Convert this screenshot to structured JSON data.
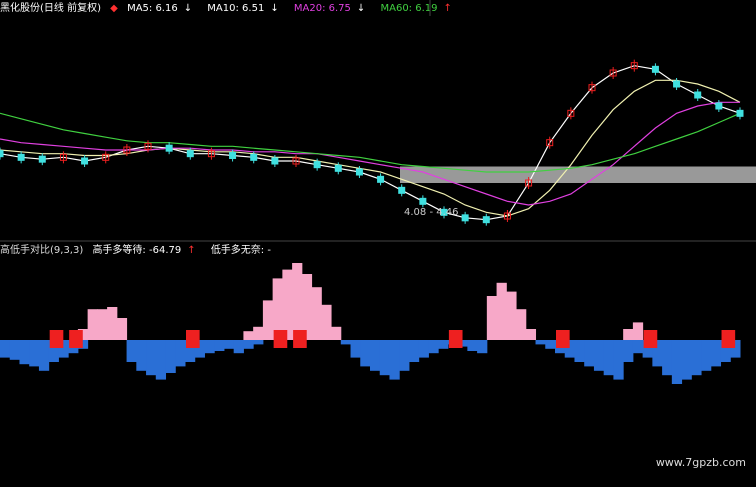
{
  "top_legend": {
    "stock": "黑化股份(日线 前复权)",
    "ma5": {
      "label": "MA5: 6.16",
      "arrow": "↓",
      "color": "#ffffff"
    },
    "ma10": {
      "label": "MA10: 6.51",
      "arrow": "↓",
      "color": "#ffffff"
    },
    "ma20": {
      "label": "MA20: 6.75",
      "arrow": "↓",
      "color": "#e040e0"
    },
    "ma60": {
      "label": "MA60: 6.19",
      "arrow": "↑",
      "color": "#40d040"
    }
  },
  "bottom_legend": {
    "indicator": "高低手对比(9,3,3)",
    "high": {
      "label": "高手多等待: -64.79",
      "arrow": "↑"
    },
    "low": {
      "label": "低手多无奈: -"
    }
  },
  "annotation": "4.08 - 4.46",
  "watermark": "www.7gpzb.com",
  "colors": {
    "pink": "#f7a8c8",
    "blue": "#2a6fd6",
    "red": "#ee2020",
    "cyan": "#40e0e0",
    "ma5": "#ffffff",
    "ma10": "#f0f0b0",
    "ma20": "#e040e0",
    "ma60": "#40d040",
    "zone": "#999999"
  },
  "chart_data": [
    {
      "type": "line",
      "title": "",
      "series": [
        {
          "name": "MA5",
          "values": [
            6.3,
            6.2,
            6.15,
            6.2,
            6.1,
            6.2,
            6.4,
            6.5,
            6.45,
            6.3,
            6.3,
            6.25,
            6.2,
            6.1,
            6.1,
            6.0,
            5.9,
            5.8,
            5.6,
            5.3,
            5.0,
            4.7,
            4.55,
            4.5,
            4.6,
            5.5,
            6.6,
            7.4,
            8.1,
            8.5,
            8.7,
            8.6,
            8.2,
            7.9,
            7.6,
            7.4
          ]
        },
        {
          "name": "MA10",
          "values": [
            6.4,
            6.35,
            6.3,
            6.3,
            6.25,
            6.25,
            6.3,
            6.4,
            6.45,
            6.4,
            6.35,
            6.35,
            6.3,
            6.2,
            6.2,
            6.1,
            6.0,
            5.9,
            5.8,
            5.6,
            5.4,
            5.2,
            4.9,
            4.7,
            4.6,
            4.8,
            5.3,
            6.0,
            6.8,
            7.5,
            8.0,
            8.3,
            8.3,
            8.2,
            8.0,
            7.7
          ]
        },
        {
          "name": "MA20",
          "values": [
            6.7,
            6.6,
            6.55,
            6.5,
            6.45,
            6.4,
            6.4,
            6.4,
            6.45,
            6.45,
            6.4,
            6.4,
            6.35,
            6.35,
            6.3,
            6.3,
            6.2,
            6.1,
            6.0,
            5.9,
            5.8,
            5.6,
            5.4,
            5.2,
            5.0,
            4.9,
            5.0,
            5.2,
            5.6,
            6.0,
            6.5,
            7.0,
            7.4,
            7.6,
            7.7,
            7.7
          ]
        },
        {
          "name": "MA60",
          "values": [
            7.4,
            7.25,
            7.1,
            6.95,
            6.85,
            6.75,
            6.65,
            6.6,
            6.6,
            6.55,
            6.5,
            6.5,
            6.45,
            6.4,
            6.35,
            6.3,
            6.25,
            6.2,
            6.1,
            6.0,
            5.95,
            5.9,
            5.85,
            5.8,
            5.8,
            5.8,
            5.85,
            5.9,
            6.0,
            6.15,
            6.3,
            6.5,
            6.7,
            6.9,
            7.15,
            7.4
          ]
        }
      ],
      "ylim": [
        4.0,
        10.0
      ],
      "zone": [
        5.5,
        5.95
      ]
    },
    {
      "type": "bar",
      "title": "",
      "series": [
        {
          "name": "高手多等待",
          "values": [
            0,
            0,
            0,
            0,
            0,
            0,
            0,
            0,
            5,
            14,
            14,
            15,
            10,
            0,
            0,
            0,
            0,
            0,
            0,
            0,
            0,
            0,
            0,
            0,
            0,
            4,
            6,
            18,
            28,
            32,
            35,
            30,
            24,
            16,
            6,
            0,
            0,
            0,
            0,
            0,
            0,
            0,
            0,
            0,
            0,
            0,
            0,
            0,
            0,
            0,
            20,
            26,
            22,
            14,
            5,
            0,
            0,
            0,
            0,
            0,
            0,
            0,
            0,
            0,
            5,
            8,
            0,
            0,
            0,
            0,
            0,
            0,
            0,
            0,
            0,
            0
          ]
        },
        {
          "name": "低手多无奈",
          "values": [
            -8,
            -9,
            -11,
            -12,
            -14,
            -10,
            -8,
            -6,
            -4,
            0,
            0,
            0,
            0,
            -10,
            -14,
            -16,
            -18,
            -15,
            -12,
            -10,
            -8,
            -6,
            -5,
            -4,
            -6,
            -4,
            -2,
            0,
            0,
            0,
            0,
            0,
            0,
            0,
            0,
            -2,
            -8,
            -12,
            -14,
            -16,
            -18,
            -14,
            -10,
            -8,
            -6,
            -4,
            -2,
            -3,
            -5,
            -6,
            0,
            0,
            0,
            0,
            0,
            -2,
            -4,
            -6,
            -8,
            -10,
            -12,
            -14,
            -16,
            -18,
            -10,
            -6,
            -8,
            -12,
            -16,
            -20,
            -18,
            -16,
            -14,
            -12,
            -10,
            -8
          ]
        },
        {
          "name": "signal",
          "values": [
            0,
            0,
            0,
            0,
            0,
            1,
            0,
            1,
            0,
            0,
            0,
            0,
            0,
            0,
            0,
            0,
            0,
            0,
            0,
            1,
            0,
            0,
            0,
            0,
            0,
            0,
            0,
            0,
            1,
            0,
            1,
            0,
            0,
            0,
            0,
            0,
            0,
            0,
            0,
            0,
            0,
            0,
            0,
            0,
            0,
            0,
            1,
            0,
            0,
            0,
            0,
            0,
            0,
            0,
            0,
            0,
            0,
            1,
            0,
            0,
            0,
            0,
            0,
            0,
            0,
            0,
            1,
            0,
            0,
            0,
            0,
            0,
            0,
            0,
            1,
            0
          ]
        }
      ]
    }
  ]
}
